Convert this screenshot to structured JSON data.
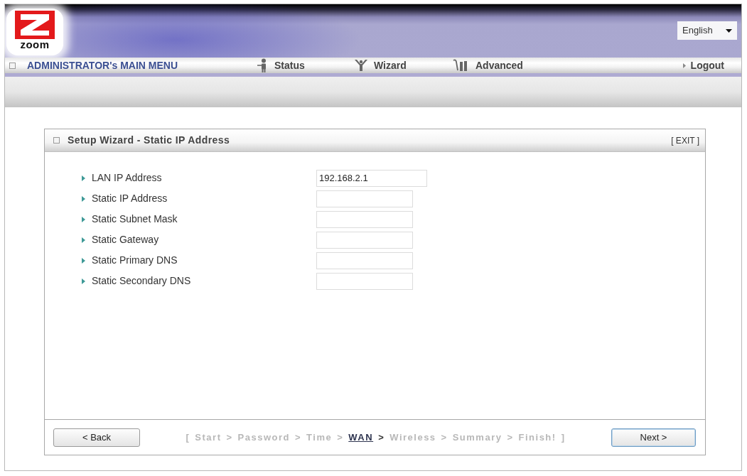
{
  "logo": {
    "text": "zoom"
  },
  "language": {
    "value": "English"
  },
  "menu": {
    "title": "ADMINISTRATOR's MAIN MENU",
    "items": [
      {
        "label": "Status",
        "kind": "status"
      },
      {
        "label": "Wizard",
        "kind": "wizard"
      },
      {
        "label": "Advanced",
        "kind": "advanced"
      }
    ],
    "logout": "Logout"
  },
  "panel": {
    "title": "Setup Wizard - Static IP Address",
    "exit": "[ EXIT ]",
    "fields": [
      {
        "label": "LAN IP Address",
        "kind": "wide",
        "value": "192.168.2.1"
      },
      {
        "label": "Static IP Address",
        "kind": "standard"
      },
      {
        "label": "Static Subnet Mask",
        "kind": "standard"
      },
      {
        "label": "Static Gateway",
        "kind": "standard"
      },
      {
        "label": "Static Primary DNS",
        "kind": "standard"
      },
      {
        "label": "Static Secondary DNS",
        "kind": "standard"
      }
    ]
  },
  "footer": {
    "back": {
      "label": "< Back",
      "default": false
    },
    "steps": {
      "open": "[",
      "close": "]",
      "items": [
        {
          "label": "Start",
          "selected": false,
          "separator": ">"
        },
        {
          "label": "Password",
          "selected": false,
          "separator": ">"
        },
        {
          "label": "Time",
          "selected": false,
          "separator": ">"
        },
        {
          "label": "WAN",
          "selected": true,
          "separator": ">"
        },
        {
          "label": "Wireless",
          "selected": false,
          "separator": ">"
        },
        {
          "label": "Summary",
          "selected": false,
          "separator": ">"
        },
        {
          "label": "Finish!",
          "selected": false
        }
      ]
    },
    "next": {
      "label": "Next >",
      "default": true
    }
  }
}
